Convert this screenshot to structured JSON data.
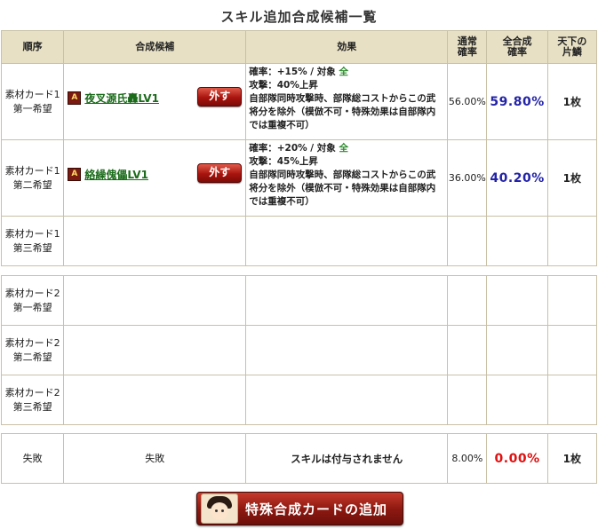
{
  "page_title": "スキル追加合成候補一覧",
  "headers": {
    "order": "順序",
    "candidate": "合成候補",
    "effect": "効果",
    "normal_rate": "通常\n確率",
    "total_rate": "全合成\n確率",
    "tenka": "天下の\n片鱗"
  },
  "material1": [
    {
      "material_label": "素材カード1\n第一希望",
      "rank_icon": "A",
      "skill_name": "夜叉源氏轟LV1",
      "remove_label": "外す",
      "effect_line1_prefix": "確率：+15% / 対象 ",
      "effect_target": "全",
      "effect_line2": "攻撃：40%上昇",
      "effect_rest": "自部隊同時攻撃時、部隊総コストからこの武将分を除外（模倣不可・特殊効果は自部隊内では重複不可）",
      "normal_rate": "56.00%",
      "total_rate": "59.80%",
      "qty": "1枚"
    },
    {
      "material_label": "素材カード1\n第二希望",
      "rank_icon": "A",
      "skill_name": "絡繰傀儡LV1",
      "remove_label": "外す",
      "effect_line1_prefix": "確率：+20% / 対象 ",
      "effect_target": "全",
      "effect_line2": "攻撃：45%上昇",
      "effect_rest": "自部隊同時攻撃時、部隊総コストからこの武将分を除外（模倣不可・特殊効果は自部隊内では重複不可）",
      "normal_rate": "36.00%",
      "total_rate": "40.20%",
      "qty": "1枚"
    },
    {
      "material_label": "素材カード1\n第三希望"
    }
  ],
  "material2": [
    {
      "material_label": "素材カード2\n第一希望"
    },
    {
      "material_label": "素材カード2\n第二希望"
    },
    {
      "material_label": "素材カード2\n第三希望"
    }
  ],
  "failure": {
    "material_label": "失敗",
    "candidate": "失敗",
    "effect": "スキルは付与されません",
    "normal_rate": "8.00%",
    "total_rate": "0.00%",
    "qty": "1枚"
  },
  "add_button_label": "特殊合成カードの追加",
  "colors": {
    "header_bg": "#e7e0c4",
    "blue_rate": "#2323a8",
    "red_rate": "#e01010",
    "link_green": "#1b6b1b"
  }
}
